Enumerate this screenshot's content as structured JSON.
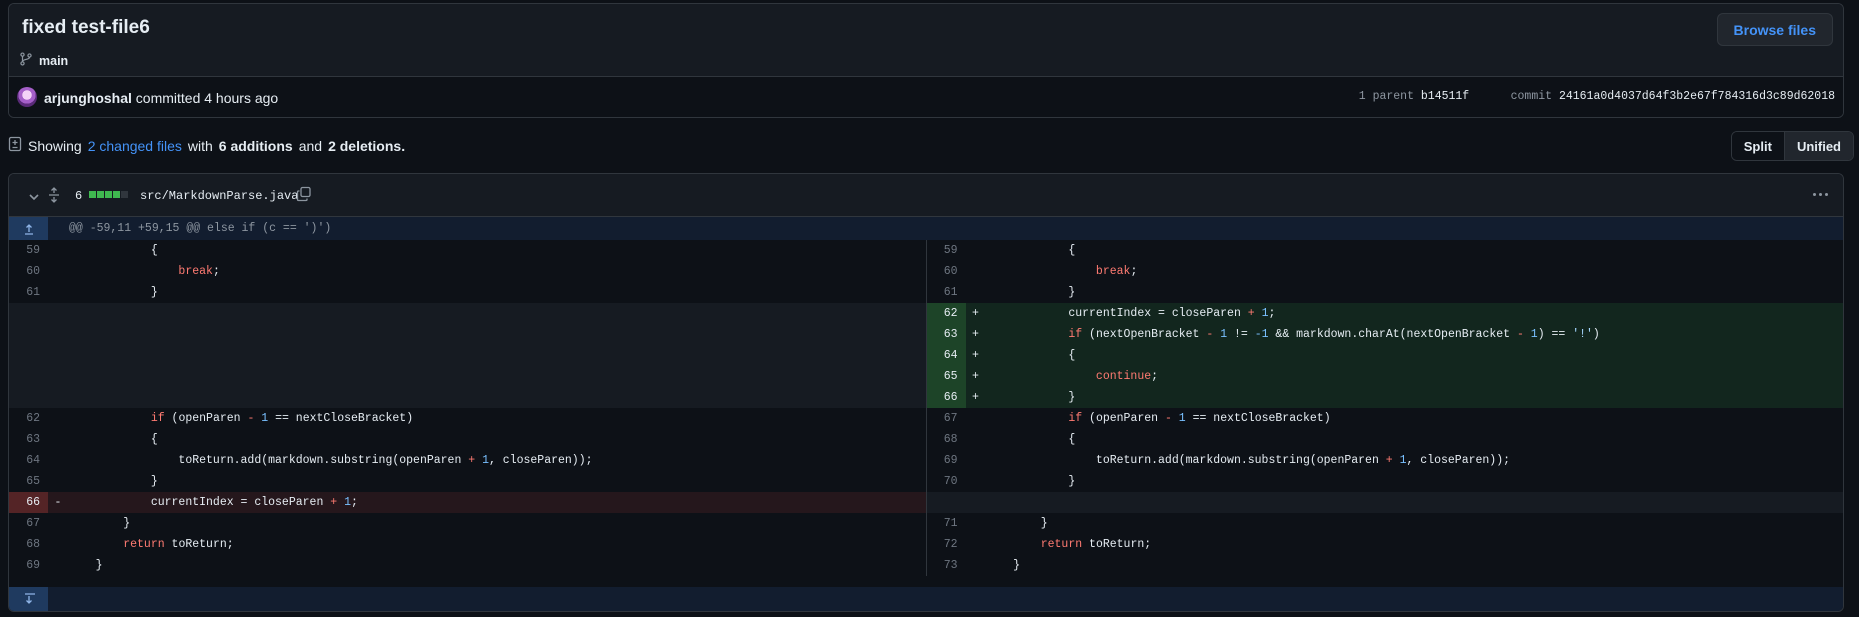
{
  "commit": {
    "title": "fixed test-file6",
    "branch": "main",
    "browse_label": "Browse files",
    "author": "arjunghoshal",
    "action": "committed 4 hours ago",
    "parent_label": "1 parent",
    "parent_hash": "b14511f",
    "commit_label": "commit",
    "commit_hash": "24161a0d4037d64f3b2e67f784316d3c89d62018"
  },
  "summary": {
    "prefix": "Showing",
    "changed_files": "2 changed files",
    "with": "with",
    "additions": "6 additions",
    "and": "and",
    "deletions": "2 deletions."
  },
  "view_toggle": {
    "split": "Split",
    "unified": "Unified",
    "active": "unified"
  },
  "file": {
    "change_count": "6",
    "path": "src/MarkdownParse.java",
    "diffstat": [
      "added",
      "added",
      "added",
      "added",
      "neutral"
    ]
  },
  "hunk_header": "@@ -59,11 +59,15 @@ else if (c == ')')",
  "colors": {
    "addition": "#3fb950",
    "deletion": "#f85149",
    "link": "#4493f8"
  },
  "icons": [
    "branch-icon",
    "avatar",
    "file-diff-icon",
    "chevron-down-icon",
    "expand-icon",
    "copy-icon",
    "kebab-icon",
    "expand-up-icon",
    "expand-down-icon"
  ],
  "diff_rows": [
    {
      "left": {
        "ln": "59",
        "type": "context",
        "code": "            {"
      },
      "right": {
        "ln": "59",
        "type": "context",
        "code": "            {"
      }
    },
    {
      "left": {
        "ln": "60",
        "type": "context",
        "code": "                break;"
      },
      "right": {
        "ln": "60",
        "type": "context",
        "code": "                break;"
      }
    },
    {
      "left": {
        "ln": "61",
        "type": "context",
        "code": "            }"
      },
      "right": {
        "ln": "61",
        "type": "context",
        "code": "            }"
      }
    },
    {
      "left": {
        "ln": "",
        "type": "empty",
        "code": ""
      },
      "right": {
        "ln": "62",
        "type": "add",
        "code": "            currentIndex = closeParen + 1;"
      }
    },
    {
      "left": {
        "ln": "",
        "type": "empty",
        "code": ""
      },
      "right": {
        "ln": "63",
        "type": "add",
        "code": "            if (nextOpenBracket - 1 != -1 && markdown.charAt(nextOpenBracket - 1) == '!')"
      }
    },
    {
      "left": {
        "ln": "",
        "type": "empty",
        "code": ""
      },
      "right": {
        "ln": "64",
        "type": "add",
        "code": "            {"
      }
    },
    {
      "left": {
        "ln": "",
        "type": "empty",
        "code": ""
      },
      "right": {
        "ln": "65",
        "type": "add",
        "code": "                continue;"
      }
    },
    {
      "left": {
        "ln": "",
        "type": "empty",
        "code": ""
      },
      "right": {
        "ln": "66",
        "type": "add",
        "code": "            }"
      }
    },
    {
      "left": {
        "ln": "62",
        "type": "context",
        "code": "            if (openParen - 1 == nextCloseBracket)"
      },
      "right": {
        "ln": "67",
        "type": "context",
        "code": "            if (openParen - 1 == nextCloseBracket)"
      }
    },
    {
      "left": {
        "ln": "63",
        "type": "context",
        "code": "            {"
      },
      "right": {
        "ln": "68",
        "type": "context",
        "code": "            {"
      }
    },
    {
      "left": {
        "ln": "64",
        "type": "context",
        "code": "                toReturn.add(markdown.substring(openParen + 1, closeParen));"
      },
      "right": {
        "ln": "69",
        "type": "context",
        "code": "                toReturn.add(markdown.substring(openParen + 1, closeParen));"
      }
    },
    {
      "left": {
        "ln": "65",
        "type": "context",
        "code": "            }"
      },
      "right": {
        "ln": "70",
        "type": "context",
        "code": "            }"
      }
    },
    {
      "left": {
        "ln": "66",
        "type": "del",
        "code": "            currentIndex = closeParen + 1;"
      },
      "right": {
        "ln": "",
        "type": "empty",
        "code": ""
      }
    },
    {
      "left": {
        "ln": "67",
        "type": "context",
        "code": "        }"
      },
      "right": {
        "ln": "71",
        "type": "context",
        "code": "        }"
      }
    },
    {
      "left": {
        "ln": "68",
        "type": "context",
        "code": "        return toReturn;"
      },
      "right": {
        "ln": "72",
        "type": "context",
        "code": "        return toReturn;"
      }
    },
    {
      "left": {
        "ln": "69",
        "type": "context",
        "code": "    }"
      },
      "right": {
        "ln": "73",
        "type": "context",
        "code": "    }"
      }
    }
  ]
}
